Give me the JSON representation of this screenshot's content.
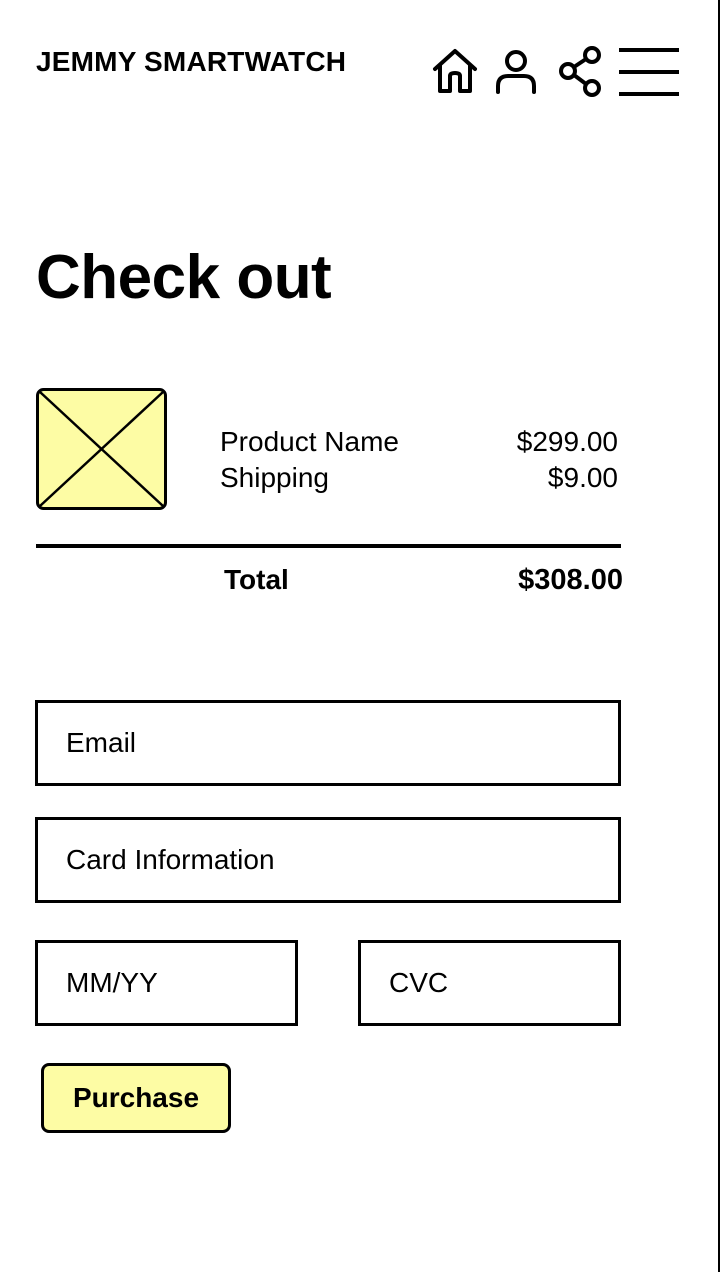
{
  "header": {
    "brand": "JEMMY SMARTWATCH",
    "icons": [
      "home-icon",
      "user-icon",
      "share-icon",
      "menu-icon"
    ]
  },
  "page": {
    "title": "Check out"
  },
  "order": {
    "items": [
      {
        "label": "Product Name",
        "price": "$299.00"
      },
      {
        "label": "Shipping",
        "price": "$9.00"
      }
    ],
    "total_label": "Total",
    "total_value": "$308.00"
  },
  "form": {
    "email_placeholder": "Email",
    "card_placeholder": "Card Information",
    "expiry_placeholder": "MM/YY",
    "cvc_placeholder": "CVC",
    "purchase_label": "Purchase"
  },
  "colors": {
    "accent": "#fdfca4",
    "ink": "#000000",
    "background": "#ffffff"
  }
}
